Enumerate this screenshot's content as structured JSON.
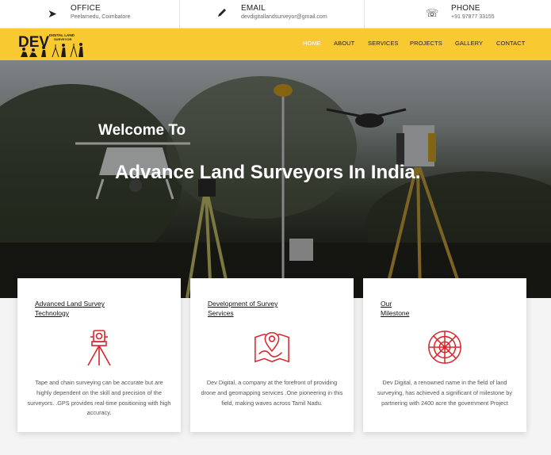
{
  "topbar": {
    "office": {
      "icon": "send-arrow-icon",
      "label": "OFFICE",
      "value": "Peelamedu, Coimbatore"
    },
    "email": {
      "icon": "pen-icon",
      "label": "EMAIL",
      "value": "devdigitallandsurveyor@gmail.com"
    },
    "phone": {
      "icon": "phone-icon",
      "label": "PHONE",
      "value": "+91 97877 33155"
    }
  },
  "logo": {
    "text_main": "DEV",
    "text_sub_1": "DIGITAL LAND",
    "text_sub_2": "SURVEYOR"
  },
  "nav": {
    "items": [
      {
        "label": "HOME",
        "active": true
      },
      {
        "label": "ABOUT",
        "active": false
      },
      {
        "label": "SERVICES",
        "active": false
      },
      {
        "label": "PROJECTS",
        "active": false
      },
      {
        "label": "GALLERY",
        "active": false
      },
      {
        "label": "CONTACT",
        "active": false
      }
    ]
  },
  "hero": {
    "welcome": "Welcome To",
    "title": "Advance Land Surveyors In India."
  },
  "cards": [
    {
      "title_line1": "Advanced Land Survey",
      "title_line2": "Technology",
      "icon": "surveying-tripod-icon",
      "desc": "Tape and chain surveying can be accurate but are highly dependent on the skill and precision of the surveyors. .GPS provides real-time positioning with high accuracy."
    },
    {
      "title_line1": "Development of Survey",
      "title_line2": "Services",
      "icon": "map-location-icon",
      "desc": "Dev Digital, a company at the forefront of providing drone and geomapping services .One pioneering in this field, making waves across Tamil Nadu."
    },
    {
      "title_line1": "Our",
      "title_line2": "Milestone",
      "icon": "radar-target-icon",
      "desc": "Dev Digital, a renowned name in the field of land surveying, has achieved a significant of milestone by partnering with 2400 acre the government Project"
    }
  ],
  "colors": {
    "accent_yellow": "#f9c932",
    "icon_red": "#d9262c"
  }
}
